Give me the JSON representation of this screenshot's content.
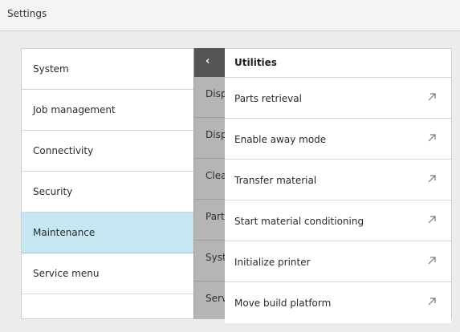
{
  "window": {
    "title": "Settings"
  },
  "categories": [
    {
      "label": "System",
      "selected": false
    },
    {
      "label": "Job management",
      "selected": false
    },
    {
      "label": "Connectivity",
      "selected": false
    },
    {
      "label": "Security",
      "selected": false
    },
    {
      "label": "Maintenance",
      "selected": true
    },
    {
      "label": "Service menu",
      "selected": false
    }
  ],
  "submenu": {
    "back_icon": "chevron-left-icon",
    "items": [
      {
        "label": "Disp"
      },
      {
        "label": "Disp"
      },
      {
        "label": "Clea"
      },
      {
        "label": "Part"
      },
      {
        "label": "Syst"
      },
      {
        "label": "Serv"
      }
    ]
  },
  "utilities": {
    "title": "Utilities",
    "item_icon": "arrow-up-right-icon",
    "items": [
      {
        "label": "Parts retrieval"
      },
      {
        "label": "Enable away mode"
      },
      {
        "label": "Transfer material"
      },
      {
        "label": "Start material conditioning"
      },
      {
        "label": "Initialize printer"
      },
      {
        "label": "Move build platform"
      }
    ]
  },
  "colors": {
    "selected_bg": "#c6e6f1",
    "back_button_bg": "#555555",
    "submenu_bg": "#b5b5b5"
  }
}
